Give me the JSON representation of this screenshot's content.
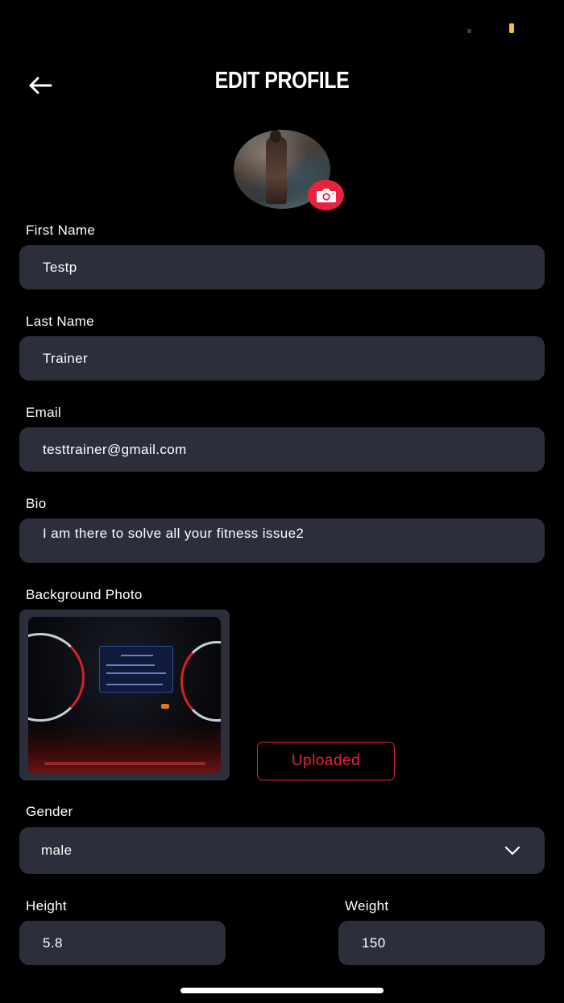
{
  "header": {
    "title": "EDIT PROFILE",
    "back_icon": "arrow-left-icon"
  },
  "avatar": {
    "camera_icon": "camera-icon",
    "accent_color": "#e8223f"
  },
  "form": {
    "first_name": {
      "label": "First Name",
      "value": "Testp"
    },
    "last_name": {
      "label": "Last Name",
      "value": "Trainer"
    },
    "email": {
      "label": "Email",
      "value": "testtrainer@gmail.com"
    },
    "bio": {
      "label": "Bio",
      "value": "I am there to solve all your fitness issue2"
    },
    "background_photo": {
      "label": "Background Photo",
      "status_label": "Uploaded"
    },
    "gender": {
      "label": "Gender",
      "value": "male",
      "icon": "chevron-down-icon"
    },
    "height": {
      "label": "Height",
      "value": "5.8"
    },
    "weight": {
      "label": "Weight",
      "value": "150"
    }
  },
  "colors": {
    "background": "#000000",
    "field_background": "#2c2e3b",
    "accent": "#e8223f",
    "text": "#ffffff"
  }
}
